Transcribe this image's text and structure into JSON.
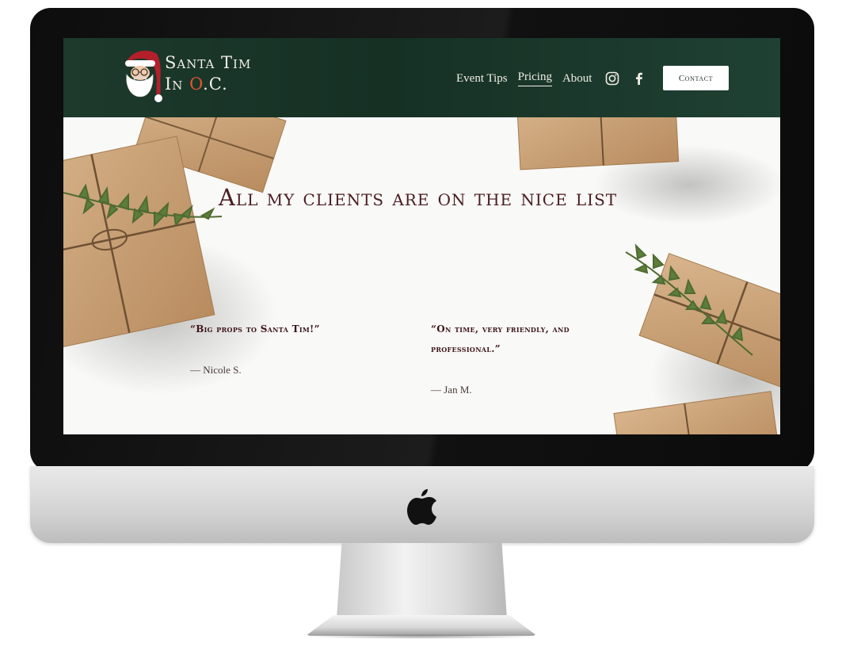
{
  "site": {
    "logo_line1": "Santa Tim",
    "logo_line2_prefix": "In ",
    "logo_line2_accent": "O",
    "logo_line2_suffix": ".C.",
    "nav": [
      {
        "label": "Event Tips"
      },
      {
        "label": "Pricing",
        "active": true
      },
      {
        "label": "About"
      }
    ],
    "social_icons": [
      "instagram-icon",
      "facebook-icon"
    ],
    "contact_label": "Contact"
  },
  "hero": {
    "headline": "All my clients are on the nice list",
    "testimonials": [
      {
        "quote": "“Big props to Santa Tim!”",
        "author": "— Nicole S."
      },
      {
        "quote": "“On time, very friendly, and professional.”",
        "author": "— Jan M."
      }
    ]
  },
  "colors": {
    "header_bg": "#163024",
    "accent": "#e2552f",
    "headline": "#4a1c20",
    "bezel": "#0d0d0d",
    "chin": "#d3d3d3"
  },
  "device": {
    "logo_icon": "apple-logo-icon"
  }
}
